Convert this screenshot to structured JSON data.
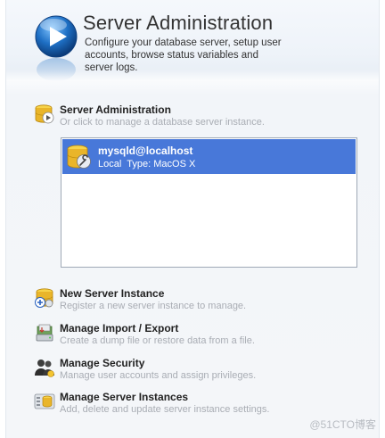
{
  "header": {
    "title": "Server Administration",
    "description": "Configure your database server, setup user accounts, browse status variables and server logs."
  },
  "server_admin": {
    "title": "Server Administration",
    "description": "Or click to manage a database server instance."
  },
  "instances": [
    {
      "name": "mysqld@localhost",
      "location": "Local",
      "type": "Type: MacOS X",
      "selected": true
    }
  ],
  "actions": {
    "new_instance": {
      "title": "New Server Instance",
      "description": "Register a new server instance to manage."
    },
    "import_export": {
      "title": "Manage Import / Export",
      "description": "Create a dump file or restore data from a file."
    },
    "security": {
      "title": "Manage Security",
      "description": "Manage user accounts and assign privileges."
    },
    "server_instances": {
      "title": "Manage Server Instances",
      "description": "Add, delete and update server instance settings."
    }
  },
  "watermark": "@51CTO博客",
  "colors": {
    "selection": "#4878d9",
    "accent_blue": "#1e6fc4",
    "description_gray": "#a9adb4"
  },
  "icons": {
    "header": "play-circle-icon",
    "server_admin": "database-play-icon",
    "instance": "database-wrench-icon",
    "new_instance": "database-add-icon",
    "import_export": "disk-drive-icon",
    "security": "users-icon",
    "server_instances": "database-settings-icon"
  }
}
